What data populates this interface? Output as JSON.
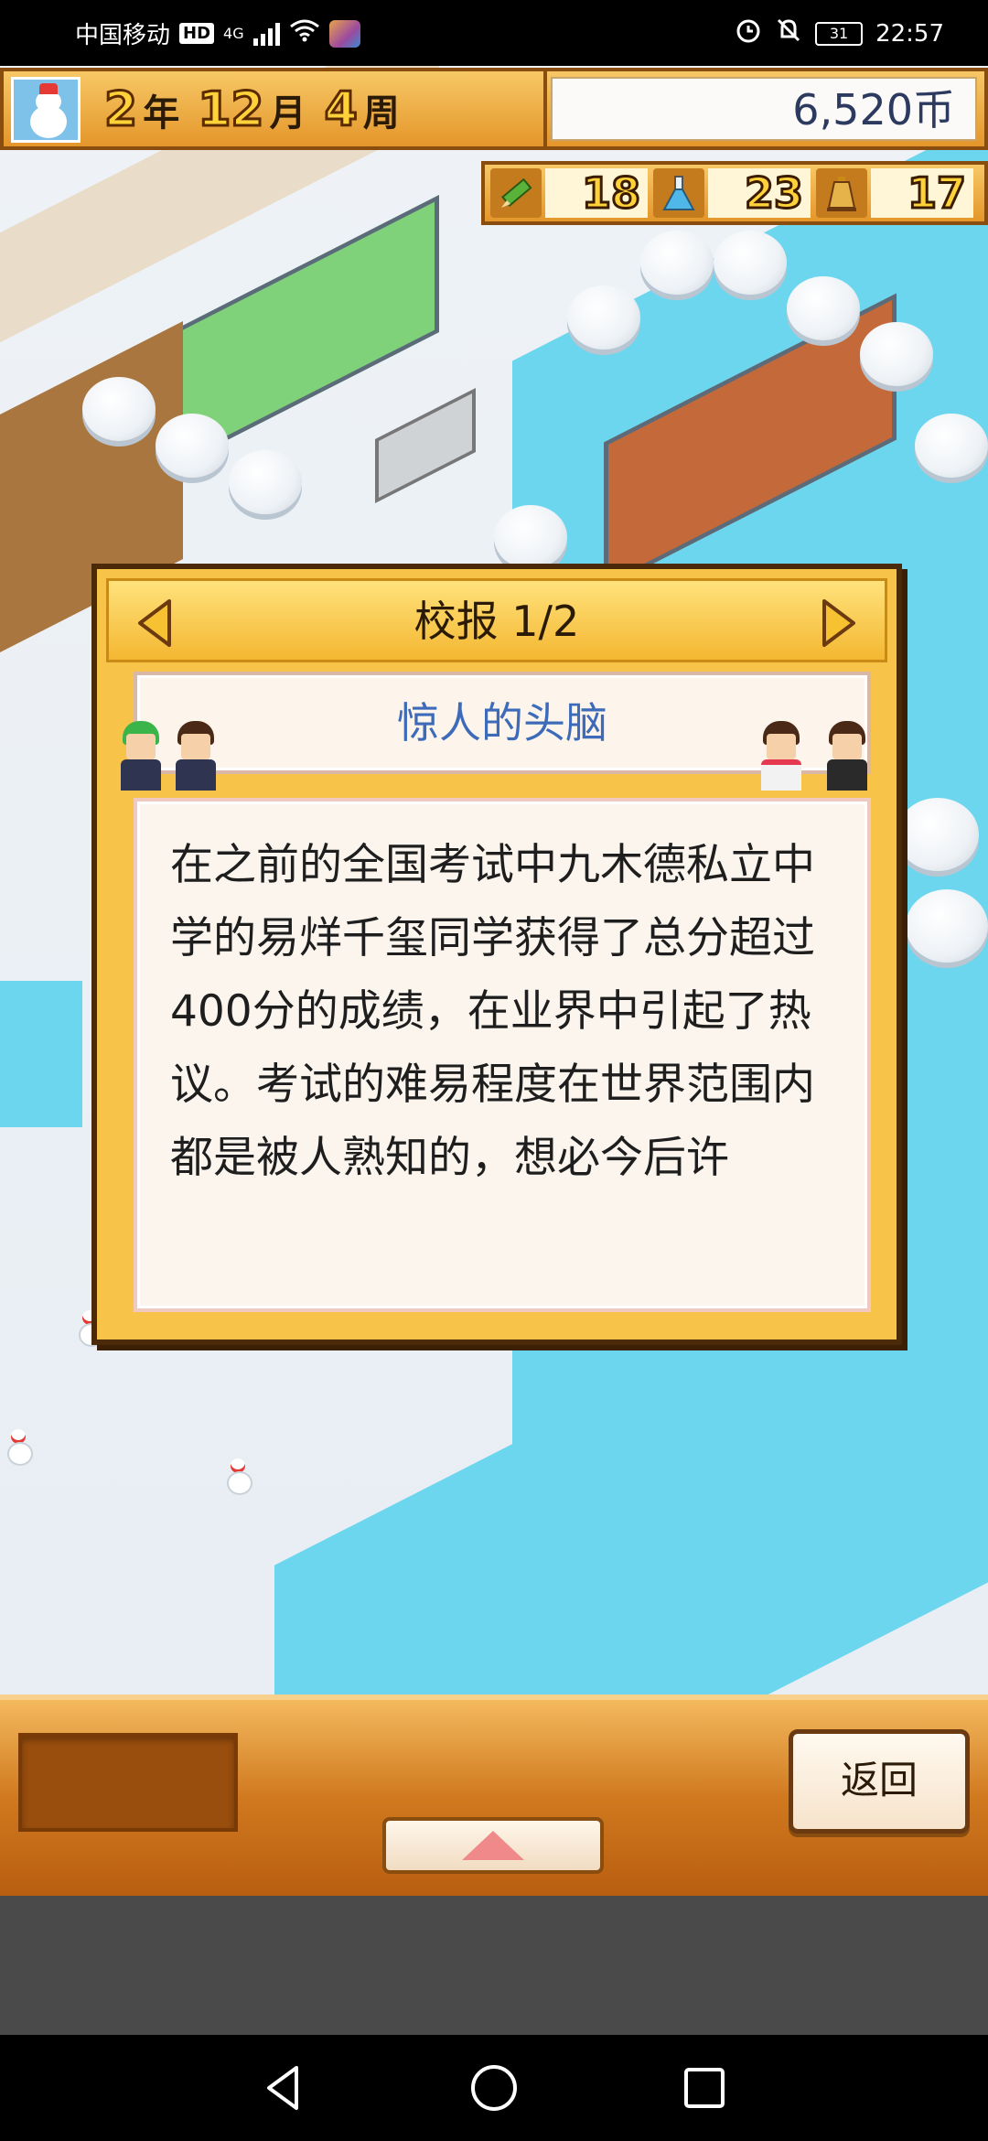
{
  "status_bar": {
    "carrier": "中国移动",
    "hd": "HD",
    "network": "4G",
    "battery": "31",
    "time": "22:57",
    "icons": [
      "hd-icon",
      "signal-icon",
      "wifi-icon",
      "app-notification-icon",
      "alarm-icon",
      "mute-icon",
      "battery-icon"
    ]
  },
  "hud": {
    "year_value": "2",
    "year_unit": "年",
    "month_value": "12",
    "month_unit": "月",
    "week_value": "4",
    "week_unit": "周",
    "money": "6,520币",
    "stats": [
      {
        "icon": "pencil-icon",
        "value": "18"
      },
      {
        "icon": "flask-icon",
        "value": "23"
      },
      {
        "icon": "bell-icon",
        "value": "17"
      }
    ]
  },
  "dialog": {
    "title": "校报 1/2",
    "headline": "惊人的头脑",
    "body": "在之前的全国考试中九木德私立中学的易烊千玺同学获得了总分超过400分的成绩，在业界中引起了热议。考试的难易程度在世界范围内都是被人熟知的，想必今后许"
  },
  "bottom": {
    "back_label": "返回"
  },
  "colors": {
    "accent_gold": "#f7c349",
    "headline_blue": "#3d6bb9",
    "water": "#6cd6ef",
    "panel_brown": "#d0791f"
  }
}
